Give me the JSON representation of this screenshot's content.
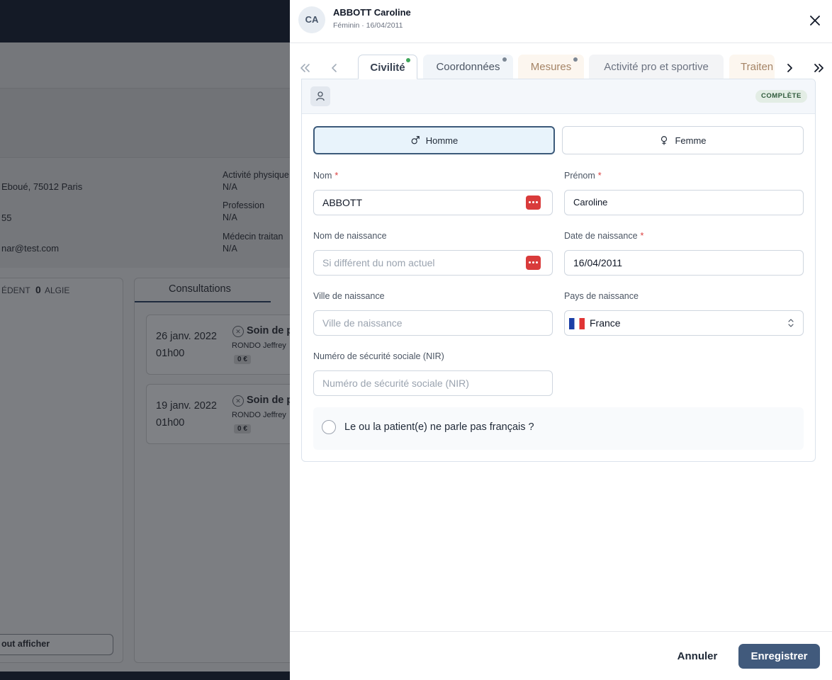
{
  "background": {
    "address": "Eboué, 75012 Paris",
    "phone": "55",
    "email": "nar@test.com",
    "activite_label": "Activité physique",
    "activite_value": "N/A",
    "profession_label": "Profession",
    "profession_value": "N/A",
    "medecin_label": "Médecin traitan",
    "medecin_value": "N/A",
    "counter_left": "ÉDENT",
    "counter_zero": "0",
    "counter_right": "ALGIE",
    "consultations_tab": "Consultations",
    "consultations": [
      {
        "date": "26 janv. 2022",
        "time": "01h00",
        "title": "Soin de p",
        "practitioner": "RONDO Jeffrey",
        "price": "0 €"
      },
      {
        "date": "19 janv. 2022",
        "time": "01h00",
        "title": "Soin de p",
        "practitioner": "RONDO Jeffrey",
        "price": "0 €"
      }
    ],
    "show_all_label": "out afficher"
  },
  "patient": {
    "initials": "CA",
    "name": "ABBOTT Caroline",
    "meta": "Féminin · 16/04/2011"
  },
  "tabs": [
    {
      "label": "Civilité",
      "dot": "#3fa65a"
    },
    {
      "label": "Coordonnées",
      "dot": "#7c8794"
    },
    {
      "label": "Mesures",
      "dot": "#7c8794"
    },
    {
      "label": "Activité pro et sportive"
    },
    {
      "label": "Traiten"
    }
  ],
  "section": {
    "status_badge": "COMPLÈTE"
  },
  "gender": {
    "homme": "Homme",
    "femme": "Femme",
    "selected": "homme"
  },
  "form": {
    "nom_label": "Nom",
    "nom_value": "ABBOTT",
    "prenom_label": "Prénom",
    "prenom_value": "Caroline",
    "nom_naissance_label": "Nom de naissance",
    "nom_naissance_placeholder": "Si différent du nom actuel",
    "date_naissance_label": "Date de naissance",
    "date_naissance_value": "16/04/2011",
    "ville_label": "Ville de naissance",
    "ville_placeholder": "Ville de naissance",
    "pays_label": "Pays de naissance",
    "pays_value": "France",
    "nir_label": "Numéro de sécurité sociale (NIR)",
    "nir_placeholder": "Numéro de sécurité sociale (NIR)",
    "required_mark": "*",
    "french_question": "Le ou la patient(e) ne parle pas français ?"
  },
  "footer": {
    "cancel": "Annuler",
    "save": "Enregistrer"
  },
  "colors": {
    "primary": "#415a7c",
    "required": "#dc3f3f",
    "status_ok": "#3fa65a"
  }
}
